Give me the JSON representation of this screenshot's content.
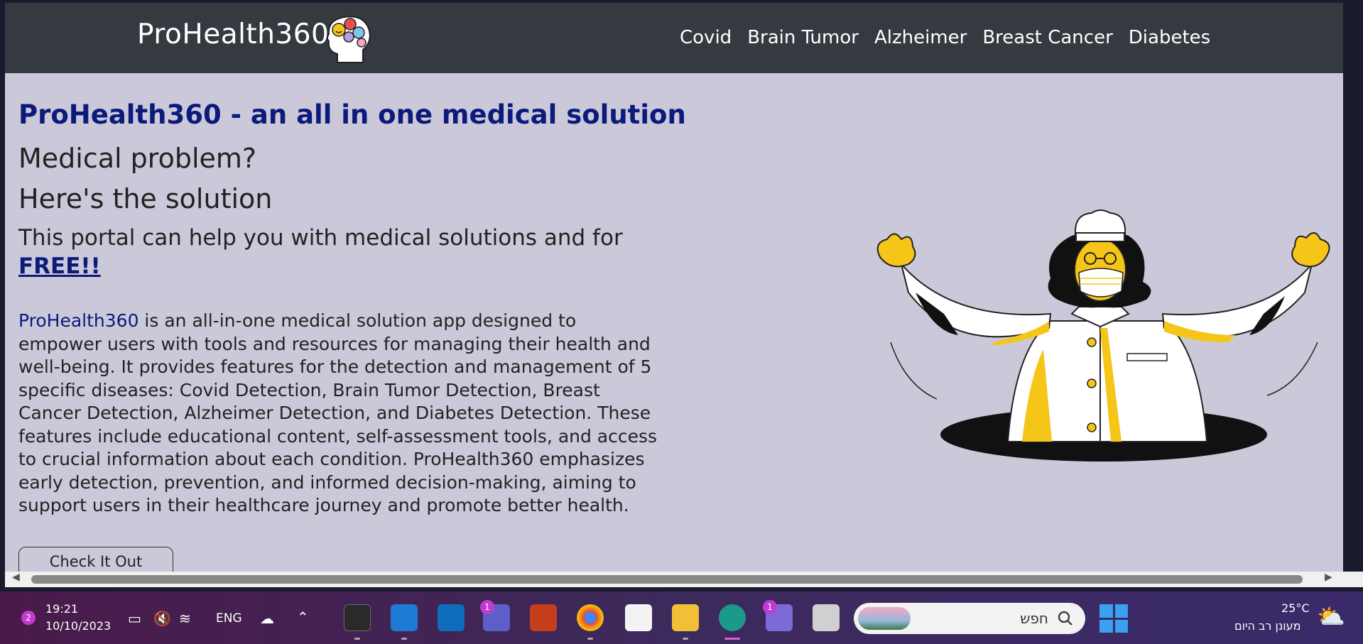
{
  "navbar": {
    "brand": "ProHealth360",
    "links": [
      "Covid",
      "Brain Tumor",
      "Alzheimer",
      "Breast Cancer",
      "Diabetes"
    ]
  },
  "hero": {
    "title": "ProHealth360 - an all in one medical solution",
    "subtitle1": "Medical problem?",
    "subtitle2": "Here's the solution",
    "lead": "This portal can help you with medical solutions and for",
    "lead_link": "FREE!!",
    "para_brand": "ProHealth360",
    "para_text": " is an all-in-one medical solution app designed to empower users with tools and resources for managing their health and well-being. It provides features for the detection and management of 5 specific diseases: Covid Detection, Brain Tumor Detection, Breast Cancer Detection, Alzheimer Detection, and Diabetes Detection. These features include educational content, self-assessment tools, and access to crucial information about each condition. ProHealth360 emphasizes early detection, prevention, and informed decision-making, aiming to support users in their healthcare journey and promote better health.",
    "button": "Check It Out"
  },
  "taskbar": {
    "notification_count": "2",
    "time": "19:21",
    "date": "10/10/2023",
    "lang": "ENG",
    "search_placeholder": "חפש",
    "weather_temp": "25°C",
    "weather_desc": "מעונן רב היום",
    "teams_badge": "1",
    "chat_badge": "1"
  },
  "colors": {
    "navbar_bg": "#343a40",
    "page_bg": "#cbc8d9",
    "brand_blue": "#0c1a7a"
  }
}
